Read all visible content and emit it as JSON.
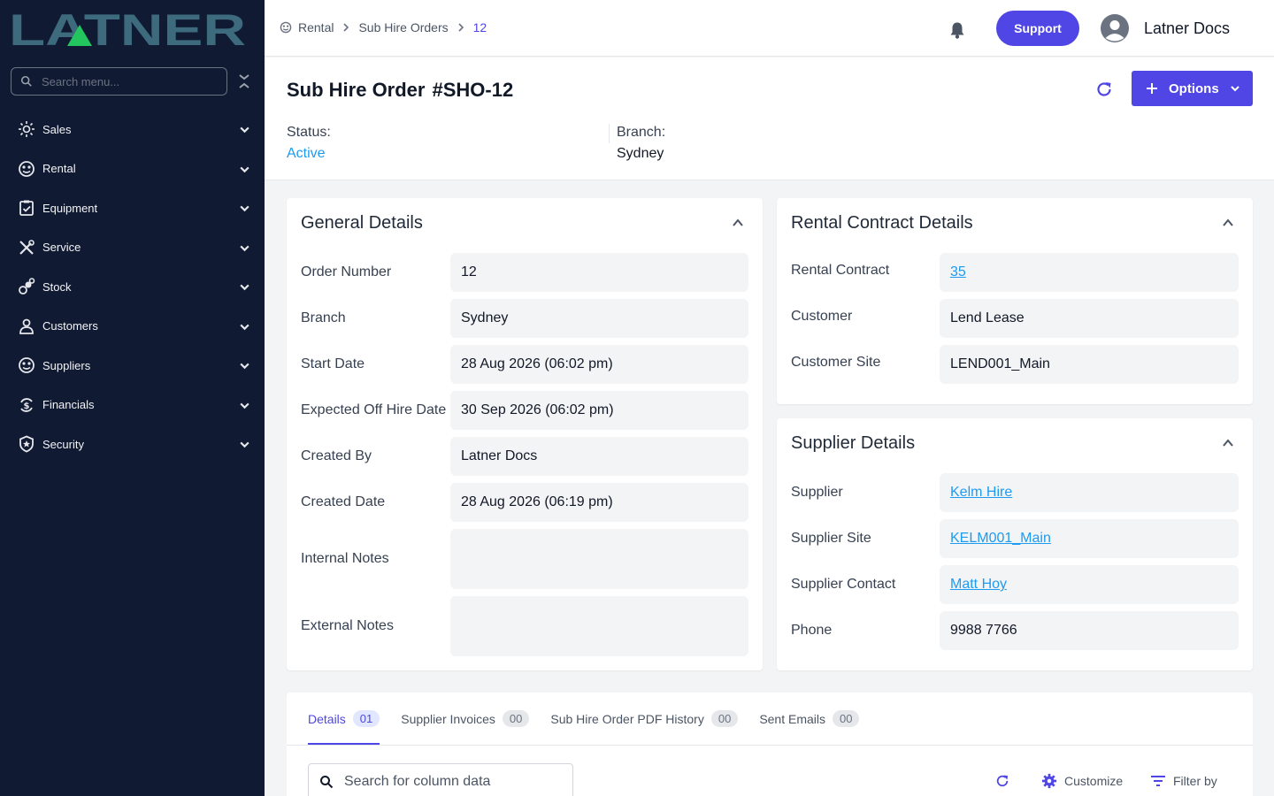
{
  "brand": {
    "logo_text": "LATNER",
    "accent": "#4f46e5",
    "sidebar_bg": "#111a33"
  },
  "sidebar": {
    "search_placeholder": "Search menu...",
    "items": [
      {
        "label": "Sales",
        "icon": "sales-icon"
      },
      {
        "label": "Rental",
        "icon": "rental-icon"
      },
      {
        "label": "Equipment",
        "icon": "equipment-icon"
      },
      {
        "label": "Service",
        "icon": "service-icon"
      },
      {
        "label": "Stock",
        "icon": "stock-icon"
      },
      {
        "label": "Customers",
        "icon": "customers-icon"
      },
      {
        "label": "Suppliers",
        "icon": "suppliers-icon"
      },
      {
        "label": "Financials",
        "icon": "financials-icon"
      },
      {
        "label": "Security",
        "icon": "security-icon"
      }
    ]
  },
  "breadcrumb": {
    "items": [
      "Rental",
      "Sub Hire Orders"
    ],
    "current": "12"
  },
  "topbar": {
    "support_label": "Support",
    "user_name": "Latner Docs"
  },
  "header": {
    "title": "Sub Hire Order",
    "order_code": "#SHO-12",
    "options_label": "Options",
    "status_label": "Status:",
    "status_value": "Active",
    "branch_label": "Branch:",
    "branch_value": "Sydney"
  },
  "general_details": {
    "title": "General Details",
    "fields": [
      {
        "label": "Order Number",
        "value": "12"
      },
      {
        "label": "Branch",
        "value": "Sydney"
      },
      {
        "label": "Start Date",
        "value": "28 Aug 2026 (06:02 pm)"
      },
      {
        "label": "Expected Off Hire Date",
        "value": "30 Sep 2026 (06:02 pm)"
      },
      {
        "label": "Created By",
        "value": "Latner Docs"
      },
      {
        "label": "Created Date",
        "value": "28 Aug 2026 (06:19 pm)"
      },
      {
        "label": "Internal Notes",
        "value": ""
      },
      {
        "label": "External Notes",
        "value": ""
      }
    ]
  },
  "rental_contract_details": {
    "title": "Rental Contract Details",
    "fields": [
      {
        "label": "Rental Contract",
        "value": "35"
      },
      {
        "label": "Customer",
        "value": "Lend Lease"
      },
      {
        "label": "Customer Site",
        "value": "LEND001_Main"
      }
    ]
  },
  "supplier_details": {
    "title": "Supplier Details",
    "fields": [
      {
        "label": "Supplier",
        "value": "Kelm Hire"
      },
      {
        "label": "Supplier Site",
        "value": "KELM001_Main"
      },
      {
        "label": "Supplier Contact",
        "value": "Matt Hoy"
      },
      {
        "label": "Phone",
        "value": "9988 7766"
      }
    ]
  },
  "tabs": [
    {
      "label": "Details",
      "count": "01"
    },
    {
      "label": "Supplier Invoices",
      "count": "00"
    },
    {
      "label": "Sub Hire Order PDF History",
      "count": "00"
    },
    {
      "label": "Sent Emails",
      "count": "00"
    }
  ],
  "table_toolbar": {
    "search_placeholder": "Search for column data",
    "customize_label": "Customize",
    "filter_label": "Filter by"
  }
}
